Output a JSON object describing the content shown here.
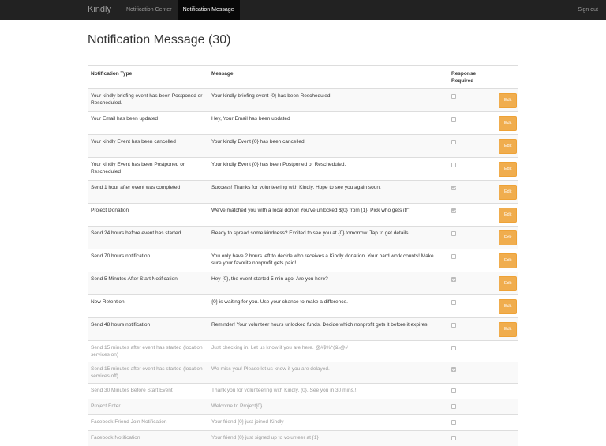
{
  "navbar": {
    "brand": "Kindly",
    "links": [
      {
        "label": "Notification Center",
        "active": false
      },
      {
        "label": "Notification Message",
        "active": true
      }
    ],
    "signout": "Sign out"
  },
  "page": {
    "title": "Notification Message (30)"
  },
  "table": {
    "headers": [
      "Notification Type",
      "Message",
      "Response Required",
      ""
    ],
    "edit_label": "Edit",
    "rows": [
      {
        "type": "Your kindly briefing event has been Postponed or Rescheduled.",
        "message": "Your kindly briefing event {0} has been Rescheduled.",
        "response": false,
        "editable": true
      },
      {
        "type": "Your Email has been updated",
        "message": "Hey, Your Email has been updated",
        "response": false,
        "editable": true
      },
      {
        "type": "Your kindly Event has been cancelled",
        "message": "Your kindly Event {0} has been cancelled.",
        "response": false,
        "editable": true
      },
      {
        "type": "Your kindly Event has been Postponed or Rescheduled",
        "message": "Your kindly Event {0} has been Postponed or Rescheduled.",
        "response": false,
        "editable": true
      },
      {
        "type": "Send 1 hour after event was completed",
        "message": "Success! Thanks for volunteering with Kindly. Hope to see you again soon.",
        "response": true,
        "editable": true
      },
      {
        "type": "Project Donation",
        "message": "We've matched you with a local donor! You've unlocked ${0} from {1}. Pick who gets it!\".",
        "response": true,
        "editable": true
      },
      {
        "type": "Send 24 hours before event has started",
        "message": "Ready to spread some kindness? Excited to see you at {0} tomorrow. Tap to get details",
        "response": false,
        "editable": true
      },
      {
        "type": "Send 70 hours notification",
        "message": "You only have 2 hours left to decide who receives a Kindly donation. Your hard work counts! Make sure your favorite nonprofit gets paid!",
        "response": false,
        "editable": true
      },
      {
        "type": "Send 5 Minutes After Start Notification",
        "message": "Hey {0}, the event started 5 min ago. Are you here?",
        "response": true,
        "editable": true
      },
      {
        "type": "New Retention",
        "message": "{0} is waiting for you. Use your chance to make a difference.",
        "response": false,
        "editable": true
      },
      {
        "type": "Send 48 hours notification",
        "message": "Reminder! Your volunteer hours unlocked funds. Decide which nonprofit gets it before it expires.",
        "response": false,
        "editable": true
      },
      {
        "type": "Send 15 minutes after event has started (location services on)",
        "message": "Just checking in. Let us know if you are here. @#$%^(&)@#",
        "response": false,
        "editable": false
      },
      {
        "type": "Send 15 minutes after event has started (location services off)",
        "message": "We miss you! Please let us know if you are delayed.",
        "response": true,
        "editable": false
      },
      {
        "type": "Send 30 Minutes Before Start Event",
        "message": "Thank you for volunteering with Kindly, {0}. See you in 30 mins.!!",
        "response": false,
        "editable": false
      },
      {
        "type": "Project Enter",
        "message": "Welcome to Project{0}",
        "response": false,
        "editable": false
      },
      {
        "type": "Facebook Friend Join Notification",
        "message": "Your friend {0} just joined Kindly",
        "response": false,
        "editable": false
      },
      {
        "type": "Facebook Notification",
        "message": "Your friend {0} just signed up to volunteer at {1}",
        "response": false,
        "editable": false
      }
    ]
  }
}
